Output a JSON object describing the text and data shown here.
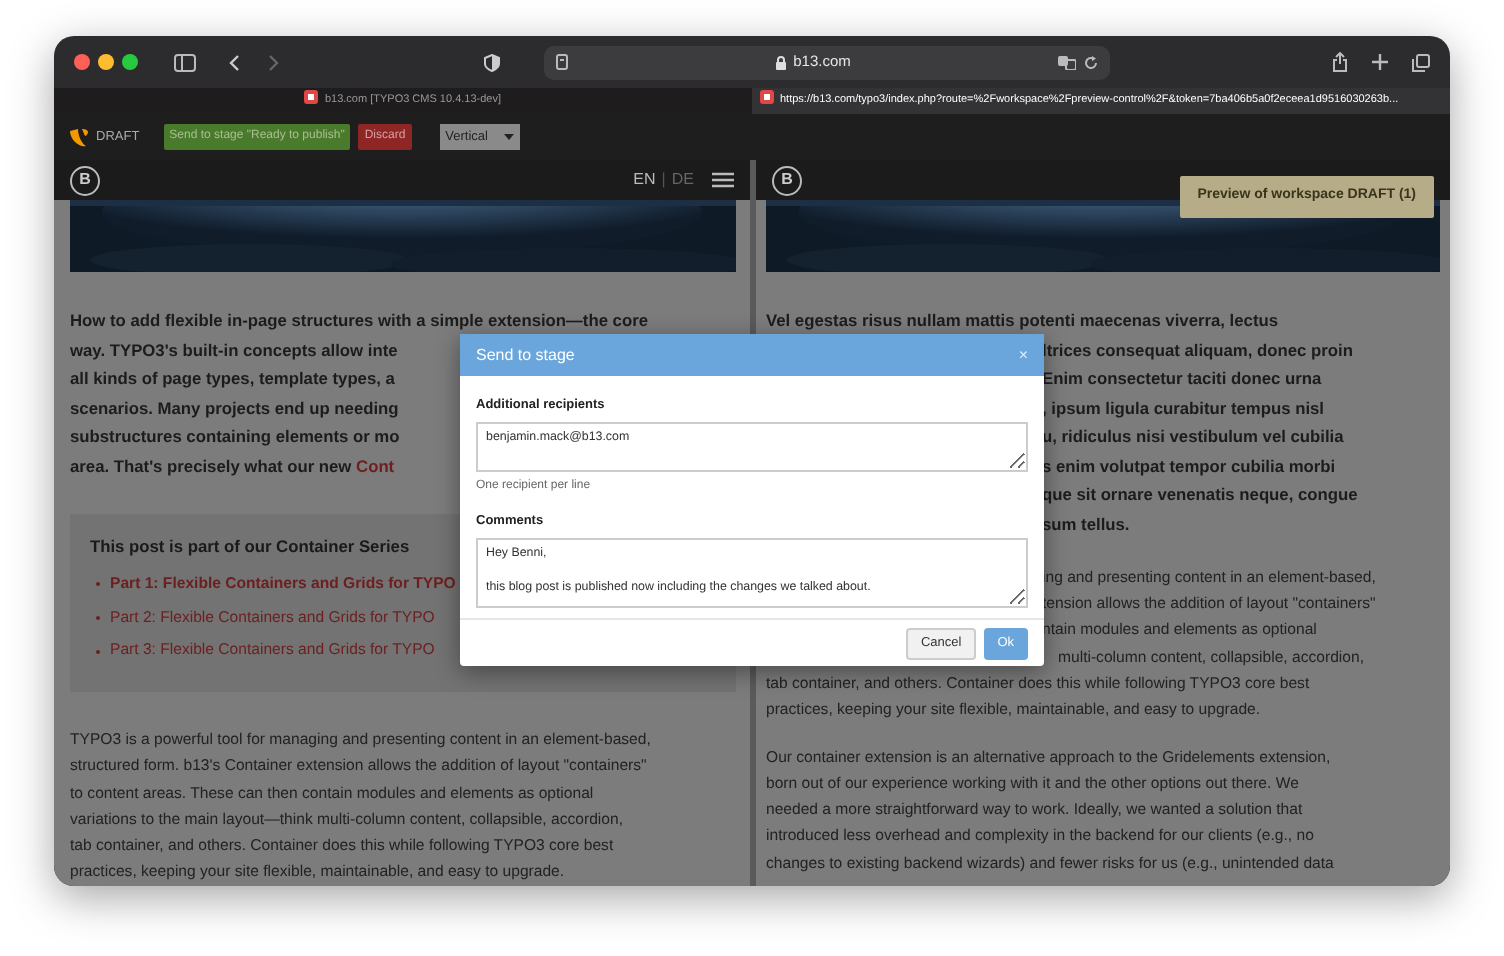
{
  "browser": {
    "address": "b13.com",
    "tabs": [
      {
        "title": "b13.com [TYPO3 CMS 10.4.13-dev]",
        "selected": false
      },
      {
        "title": "https://b13.com/typo3/index.php?route=%2Fworkspace%2Fpreview-control%2F&token=7ba406b5a0f2eceea1d9516030263b...",
        "selected": true
      }
    ]
  },
  "toolbar": {
    "workspace": "DRAFT",
    "buttons": [
      {
        "label": "Send to stage \"Ready to publish\"",
        "kind": "success"
      },
      {
        "label": "Discard",
        "kind": "danger"
      }
    ],
    "view_select": {
      "value": "Vertical"
    }
  },
  "left_pane": {
    "logo": "B",
    "language_separator": "|",
    "languages": [
      {
        "label": "EN",
        "selected": true
      },
      {
        "label": "DE",
        "selected": false
      }
    ],
    "intro_lines": [
      {
        "text": "How to add flexible in-page structures with a simple extension—the core"
      },
      {
        "text": "way. TYPO3's built-in concepts allow inte"
      },
      {
        "text": "all kinds of page types, template types, a"
      },
      {
        "text": "scenarios. Many projects end up needing"
      },
      {
        "text": "substructures containing elements or mo"
      },
      {
        "text": "area. That's precisely what our new ",
        "link": "Cont"
      }
    ],
    "series_box": {
      "title": "This post is part of our Container Series",
      "links": [
        {
          "text": "Part 1: Flexible Containers and Grids for TYPO",
          "current": true
        },
        {
          "text": "Part 2: Flexible Containers and Grids for TYPO",
          "current": false
        },
        {
          "text": "Part 3: Flexible Containers and Grids for TYPO",
          "current": false
        }
      ]
    },
    "body_lines": [
      "TYPO3 is a powerful tool for managing and presenting content in an element-based,",
      "structured form. b13's Container extension allows the addition of layout \"containers\"",
      "to content areas. These can then contain modules and elements as optional",
      "variations to the main layout—think multi-column content, collapsible, accordion,",
      "tab container, and others. Container does this while following TYPO3 core best",
      "practices, keeping your site flexible, maintainable, and easy to upgrade."
    ]
  },
  "right_pane": {
    "logo": "B",
    "badge": "Preview of workspace DRAFT (1)",
    "intro_first_line": "Vel egestas risus nullam mattis potenti maecenas viverra, lectus",
    "intro_cut_lines": [
      "ltrices consequat aliquam, donec proin",
      "Enim consectetur taciti donec urna",
      ", ipsum ligula curabitur tempus nisl",
      "u, ridiculus nisi vestibulum vel cubilia",
      "s enim volutpat tempor cubilia morbi",
      "que sit ornare venenatis neque, congue",
      "sum tellus."
    ],
    "body_cut_lines": [
      "ing and presenting content in an element-based,",
      "tension allows the addition of layout \"containers\"",
      "ntain modules and elements as optional",
      "multi-column content, collapsible, accordion,"
    ],
    "body_lines": [
      "tab container, and others. Container does this while following TYPO3 core best",
      "practices, keeping your site flexible, maintainable, and easy to upgrade."
    ],
    "second_paragraph_lines": [
      "Our container extension is an alternative approach to the Gridelements extension,",
      "born out of our experience working with it and the other options out there. We",
      "needed a more straightforward way to work. Ideally, we wanted a solution that",
      "introduced less overhead and complexity in the backend for our clients (e.g., no",
      "changes to existing backend wizards) and fewer risks for us (e.g., unintended data"
    ]
  },
  "dialog": {
    "title": "Send to stage",
    "close": "×",
    "fields": [
      {
        "label": "Additional recipients",
        "value_lines": [
          "benjamin.mack@b13.com"
        ],
        "help": "One recipient per line"
      },
      {
        "label": "Comments",
        "value_lines": [
          "Hey Benni,",
          "this blog post is published now including the changes we talked about."
        ]
      }
    ],
    "buttons": [
      {
        "label": "Cancel",
        "kind": "secondary"
      },
      {
        "label": "Ok",
        "kind": "primary"
      }
    ]
  }
}
